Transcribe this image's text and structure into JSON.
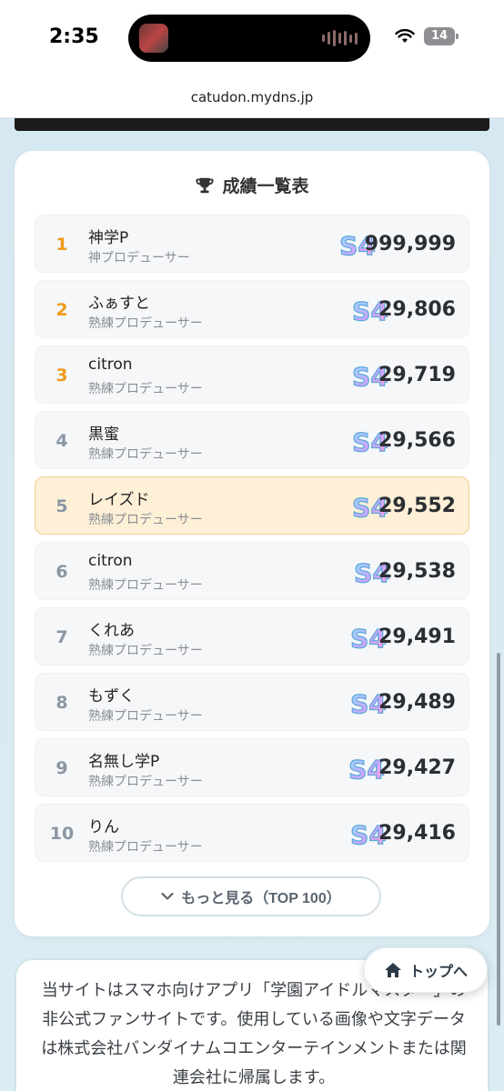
{
  "status": {
    "time": "2:35",
    "battery": "14"
  },
  "browser": {
    "url": "catudon.mydns.jp"
  },
  "ranking": {
    "title": "成績一覧表",
    "badge_label": "S4",
    "rows": [
      {
        "rank": "1",
        "name": "神学P",
        "title": "神プロデューサー",
        "score": "999,999"
      },
      {
        "rank": "2",
        "name": "ふぁすと",
        "title": "熟練プロデューサー",
        "score": "29,806"
      },
      {
        "rank": "3",
        "name": "citron",
        "title": "熟練プロデューサー",
        "score": "29,719"
      },
      {
        "rank": "4",
        "name": "黒蜜",
        "title": "熟練プロデューサー",
        "score": "29,566"
      },
      {
        "rank": "5",
        "name": "レイズド",
        "title": "熟練プロデューサー",
        "score": "29,552"
      },
      {
        "rank": "6",
        "name": "citron",
        "title": "熟練プロデューサー",
        "score": "29,538"
      },
      {
        "rank": "7",
        "name": "くれあ",
        "title": "熟練プロデューサー",
        "score": "29,491"
      },
      {
        "rank": "8",
        "name": "もずく",
        "title": "熟練プロデューサー",
        "score": "29,489"
      },
      {
        "rank": "9",
        "name": "名無し学P",
        "title": "熟練プロデューサー",
        "score": "29,427"
      },
      {
        "rank": "10",
        "name": "りん",
        "title": "熟練プロデューサー",
        "score": "29,416"
      }
    ],
    "more_label": "もっと見る（TOP 100）"
  },
  "info": {
    "text": "当サイトはスマホ向けアプリ「学園アイドルマスター」の非公式ファンサイトです。使用している画像や文字データは株式会社バンダイナムコエンターテインメントまたは関連会社に帰属します。"
  },
  "top_button": {
    "label": "トップへ"
  },
  "colors": {
    "top_rank": "#ef9a1a",
    "rank": "#8a96a3",
    "highlight_bg": "#fdf0d7",
    "highlight_border": "#f2cf91"
  }
}
